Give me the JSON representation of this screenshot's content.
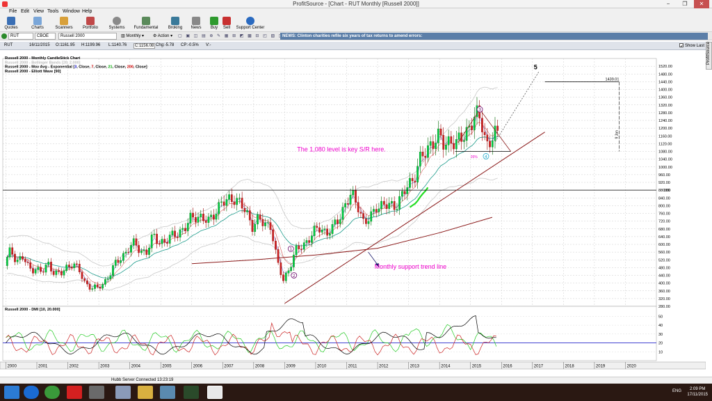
{
  "window": {
    "title": "ProfitSource - [Chart - RUT Monthly [Russell 2000]]",
    "minimize": "−",
    "restore": "❐",
    "close": "✕"
  },
  "menu": [
    "File",
    "Edit",
    "View",
    "Tools",
    "Window",
    "Help"
  ],
  "toolbar": [
    "Quotes",
    "Charts",
    "Scanners",
    "Portfolio",
    "Systems",
    "Fundamental",
    "Broking",
    "News",
    "Buy",
    "Sell",
    "Support Center"
  ],
  "symbolbar": {
    "symbol": "RUT",
    "exchange": "CBOE",
    "name": "Russell 2000",
    "period": "Monthly",
    "action": "Action",
    "news": "NEWS: Clinton charities refile six years of tax returns to amend errors:"
  },
  "quote": {
    "symbol": "RUT",
    "date": "16/11/2015",
    "open": "O:1161.95",
    "high": "H:1199.96",
    "low": "L:1140.76",
    "close": "C:1156.08",
    "change": "Chg:-5.78",
    "change_pct": "CP:-0.5%",
    "volume": "V:-",
    "show_last": "Show Last"
  },
  "side_tab": "ProfitSource",
  "chart_data": {
    "type": "candlestick",
    "legend": [
      {
        "text": "Russell 2000 - Monthly CandleStick Chart",
        "color": "#000000"
      },
      {
        "text": "Russell 2000 - Bollinger Bands [20, 2.000]",
        "color": "#bbbbbb"
      },
      {
        "text": "Russell 2000 - Mov Avg - Exponential [",
        "color": "#000000",
        "params": [
          {
            "t": "3",
            "c": "#0000cc"
          },
          {
            "t": ", Close, ",
            "c": "#000000"
          },
          {
            "t": "7",
            "c": "#cc0000"
          },
          {
            "t": ", Close, ",
            "c": "#000000"
          },
          {
            "t": "21",
            "c": "#00aa00"
          },
          {
            "t": ", Close, ",
            "c": "#000000"
          },
          {
            "t": "200",
            "c": "#cc0000"
          },
          {
            "t": ", Close]",
            "c": "#000000"
          }
        ]
      },
      {
        "text": "Russell 2000 - Elliott Wave [90]",
        "color": "#000000"
      }
    ],
    "y_axis": [
      280,
      320,
      360,
      400,
      440,
      480,
      520,
      560,
      600,
      640,
      680,
      720,
      760,
      800,
      840,
      880,
      920,
      960,
      1000,
      1040,
      1080,
      1120,
      1160,
      1200,
      1240,
      1280,
      1320,
      1360,
      1400,
      1440,
      1480,
      1520
    ],
    "y_labels": [
      "280.00",
      "320.00",
      "360.00",
      "400.00",
      "440.00",
      "480.00",
      "520.00",
      "560.00",
      "600.00",
      "640.00",
      "680.00",
      "720.00",
      "760.00",
      "800.00",
      "840.00",
      "880.00",
      "920.00",
      "960.00",
      "1000.00",
      "1040.00",
      "1080.00",
      "1120.00",
      "1160.00",
      "1200.00",
      "1240.00",
      "1280.00",
      "1320.00",
      "1360.00",
      "1400.00",
      "1440.00",
      "1480.00",
      "1520.00"
    ],
    "x_axis": [
      "2000",
      "2001",
      "2002",
      "2003",
      "2004",
      "2005",
      "2006",
      "2007",
      "2008",
      "2009",
      "2010",
      "2011",
      "2012",
      "2013",
      "2014",
      "2015",
      "2016",
      "2017",
      "2018",
      "2019",
      "2020"
    ],
    "y_range": [
      280,
      1560
    ],
    "x_range": [
      1999.9,
      2021.0
    ],
    "horizontal_line": {
      "value": 880,
      "label": "880"
    },
    "target_line": {
      "value": 1439.01,
      "label": "1439.01",
      "x_from": 2017.4,
      "x_to": 2019.8
    },
    "time_marker": {
      "x": 2019.8,
      "label": "9 Jan"
    },
    "annotations": [
      {
        "text": "The 1,080 level is key S/R here.",
        "color": "#ee00cc",
        "x": 2009.4,
        "y": 1080
      },
      {
        "text": "Monthly support trend line",
        "color": "#ee00cc",
        "x": 2011.9,
        "y": 475
      },
      {
        "text": "26%",
        "color": "#ee00cc",
        "x": 2015.0,
        "y": 1045
      }
    ],
    "wave_labels": [
      {
        "label": "1",
        "x": 2009.2,
        "y": 577
      },
      {
        "label": "2",
        "x": 2009.3,
        "y": 440
      },
      {
        "label": "3",
        "x": 2015.3,
        "y": 1297
      },
      {
        "label": "4",
        "x": 2015.5,
        "y": 1055
      },
      {
        "label": "5",
        "x": 2017.1,
        "y": 1505
      }
    ],
    "monthly_close": [
      [
        2000.0,
        490
      ],
      [
        2000.2,
        570
      ],
      [
        2000.4,
        520
      ],
      [
        2000.6,
        530
      ],
      [
        2000.8,
        470
      ],
      [
        2001.0,
        480
      ],
      [
        2001.2,
        450
      ],
      [
        2001.4,
        500
      ],
      [
        2001.6,
        460
      ],
      [
        2001.8,
        440
      ],
      [
        2002.0,
        480
      ],
      [
        2002.2,
        510
      ],
      [
        2002.4,
        460
      ],
      [
        2002.6,
        400
      ],
      [
        2002.8,
        380
      ],
      [
        2003.0,
        370
      ],
      [
        2003.2,
        400
      ],
      [
        2003.4,
        450
      ],
      [
        2003.6,
        500
      ],
      [
        2003.8,
        540
      ],
      [
        2004.0,
        580
      ],
      [
        2004.2,
        600
      ],
      [
        2004.4,
        570
      ],
      [
        2004.6,
        560
      ],
      [
        2004.8,
        640
      ],
      [
        2005.0,
        620
      ],
      [
        2005.2,
        610
      ],
      [
        2005.4,
        640
      ],
      [
        2005.6,
        670
      ],
      [
        2005.8,
        670
      ],
      [
        2006.0,
        730
      ],
      [
        2006.2,
        760
      ],
      [
        2006.4,
        720
      ],
      [
        2006.6,
        720
      ],
      [
        2006.8,
        780
      ],
      [
        2007.0,
        800
      ],
      [
        2007.2,
        830
      ],
      [
        2007.4,
        850
      ],
      [
        2007.6,
        800
      ],
      [
        2007.8,
        770
      ],
      [
        2008.0,
        700
      ],
      [
        2008.2,
        720
      ],
      [
        2008.4,
        710
      ],
      [
        2008.6,
        700
      ],
      [
        2008.8,
        500
      ],
      [
        2009.0,
        420
      ],
      [
        2009.2,
        480
      ],
      [
        2009.4,
        560
      ],
      [
        2009.6,
        600
      ],
      [
        2009.8,
        620
      ],
      [
        2010.0,
        660
      ],
      [
        2010.2,
        700
      ],
      [
        2010.4,
        650
      ],
      [
        2010.6,
        680
      ],
      [
        2010.8,
        750
      ],
      [
        2011.0,
        800
      ],
      [
        2011.2,
        850
      ],
      [
        2011.4,
        820
      ],
      [
        2011.6,
        700
      ],
      [
        2011.8,
        730
      ],
      [
        2012.0,
        810
      ],
      [
        2012.2,
        790
      ],
      [
        2012.4,
        800
      ],
      [
        2012.6,
        810
      ],
      [
        2012.8,
        830
      ],
      [
        2013.0,
        900
      ],
      [
        2013.2,
        950
      ],
      [
        2013.4,
        1020
      ],
      [
        2013.6,
        1080
      ],
      [
        2013.8,
        1140
      ],
      [
        2014.0,
        1140
      ],
      [
        2014.2,
        1120
      ],
      [
        2014.4,
        1150
      ],
      [
        2014.6,
        1100
      ],
      [
        2014.8,
        1170
      ],
      [
        2015.0,
        1210
      ],
      [
        2015.2,
        1250
      ],
      [
        2015.4,
        1250
      ],
      [
        2015.6,
        1100
      ],
      [
        2015.8,
        1160
      ]
    ],
    "indicator": {
      "title": "Russell 2000 - DMI [10, 20.000]",
      "y_axis": [
        10,
        20,
        30,
        40,
        50
      ],
      "y_range": [
        0,
        55
      ],
      "threshold": 20
    }
  },
  "status": {
    "server": "Hubb Server Connected 13:23:19"
  },
  "taskbar": {
    "lang": "ENG",
    "time": "2:09 PM",
    "date": "17/11/2015"
  }
}
